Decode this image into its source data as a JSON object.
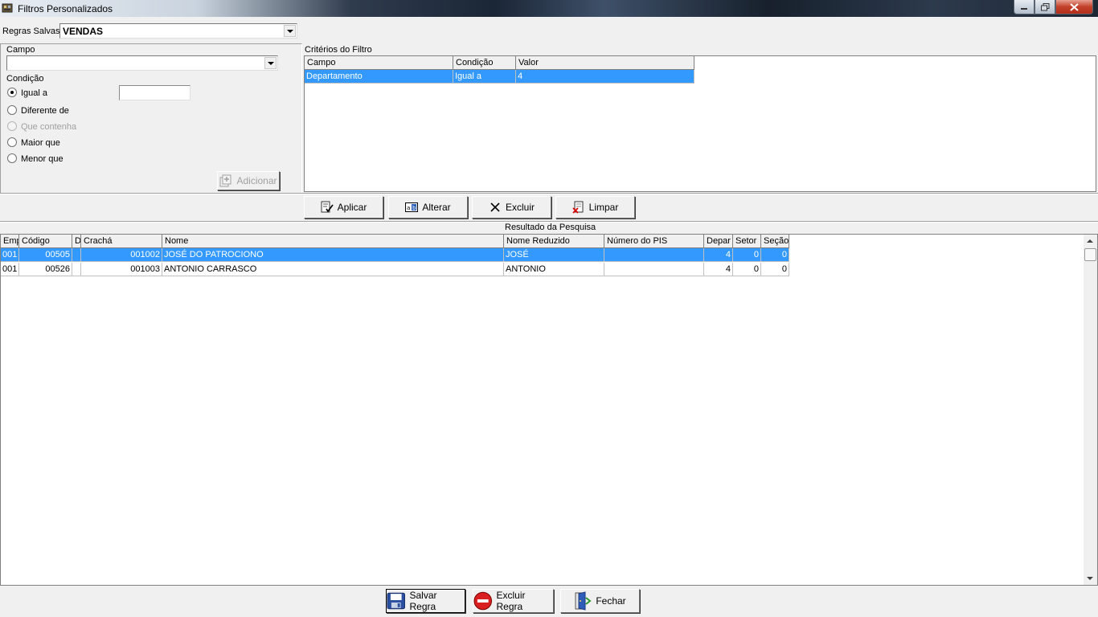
{
  "window": {
    "title": "Filtros Personalizados"
  },
  "saved_rules": {
    "label": "Regras Salvas",
    "value": "VENDAS"
  },
  "filter_editor": {
    "field_label": "Campo",
    "field_value": "",
    "condition_label": "Condição",
    "value_input": "",
    "options": [
      {
        "label": "Igual a",
        "checked": true,
        "enabled": true
      },
      {
        "label": "Diferente de",
        "checked": false,
        "enabled": true
      },
      {
        "label": "Que contenha",
        "checked": false,
        "enabled": false
      },
      {
        "label": "Maior que",
        "checked": false,
        "enabled": true
      },
      {
        "label": "Menor que",
        "checked": false,
        "enabled": true
      }
    ],
    "add_button": "Adicionar"
  },
  "criteria": {
    "title": "Critérios do Filtro",
    "columns": [
      "Campo",
      "Condição",
      "Valor"
    ],
    "rows": [
      {
        "campo": "Departamento",
        "condicao": "Igual a",
        "valor": "4",
        "selected": true
      }
    ]
  },
  "actions": {
    "apply": "Aplicar",
    "change": "Alterar",
    "delete": "Excluir",
    "clear": "Limpar"
  },
  "results": {
    "title": "Resultado da Pesquisa",
    "columns": [
      "Emp",
      "Código",
      "D",
      "Crachá",
      "Nome",
      "Nome Reduzido",
      "Número do PIS",
      "Depar",
      "Setor",
      "Seção"
    ],
    "rows": [
      {
        "emp": "001",
        "codigo": "00505",
        "d": "",
        "cracha": "001002",
        "nome": "JOSÉ DO PATROCIONO",
        "nome_reduzido": "JOSÉ",
        "pis": "",
        "depto": "4",
        "setor": "0",
        "secao": "0",
        "selected": true
      },
      {
        "emp": "001",
        "codigo": "00526",
        "d": "",
        "cracha": "001003",
        "nome": "ANTONIO CARRASCO",
        "nome_reduzido": "ANTONIO",
        "pis": "",
        "depto": "4",
        "setor": "0",
        "secao": "0",
        "selected": false
      }
    ]
  },
  "footer": {
    "save": "Salvar Regra",
    "delete": "Excluir Regra",
    "close": "Fechar"
  },
  "colors": {
    "selection": "#3399ff",
    "close_button": "#c2402a"
  }
}
